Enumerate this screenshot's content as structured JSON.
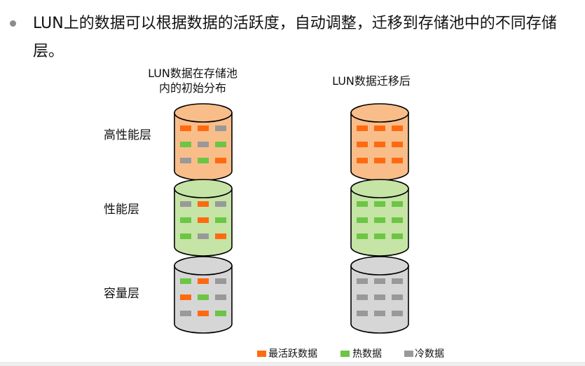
{
  "intro": "LUN上的数据可以根据数据的活跃度，自动调整，迁移到存储池中的不同存储层。",
  "columns": {
    "left_title": "LUN数据在存储池\n内的初始分布",
    "right_title": "LUN数据迁移后"
  },
  "tiers": [
    {
      "label": "高性能层",
      "body_color": "#f9bd8a",
      "top_color": "#f9bd8a",
      "before": [
        [
          "hot_active",
          "hot_active",
          "cold"
        ],
        [
          "warm",
          "cold",
          "warm"
        ],
        [
          "cold",
          "warm",
          "hot_active"
        ]
      ],
      "after": [
        [
          "hot_active",
          "hot_active",
          "hot_active"
        ],
        [
          "hot_active",
          "hot_active",
          "hot_active"
        ],
        [
          "hot_active",
          "hot_active",
          "hot_active"
        ]
      ]
    },
    {
      "label": "性能层",
      "body_color": "#c5e4a6",
      "top_color": "#c5e4a6",
      "before": [
        [
          "cold",
          "hot_active",
          "cold"
        ],
        [
          "warm",
          "hot_active",
          "warm"
        ],
        [
          "warm",
          "cold",
          "hot_active"
        ]
      ],
      "after": [
        [
          "warm",
          "warm",
          "warm"
        ],
        [
          "warm",
          "warm",
          "warm"
        ],
        [
          "warm",
          "warm",
          "warm"
        ]
      ]
    },
    {
      "label": "容量层",
      "body_color": "#d6d6d6",
      "top_color": "#d6d6d6",
      "before": [
        [
          "warm",
          "hot_active",
          "cold"
        ],
        [
          "hot_active",
          "warm",
          "cold"
        ],
        [
          "cold",
          "hot_active",
          "warm"
        ]
      ],
      "after": [
        [
          "cold",
          "cold",
          "cold"
        ],
        [
          "cold",
          "cold",
          "cold"
        ],
        [
          "cold",
          "cold",
          "cold"
        ]
      ]
    }
  ],
  "legend": [
    {
      "key": "hot_active",
      "label": "最活跃数据",
      "color": "#ff6a10"
    },
    {
      "key": "warm",
      "label": "热数据",
      "color": "#6cc644"
    },
    {
      "key": "cold",
      "label": "冷数据",
      "color": "#999999"
    }
  ]
}
